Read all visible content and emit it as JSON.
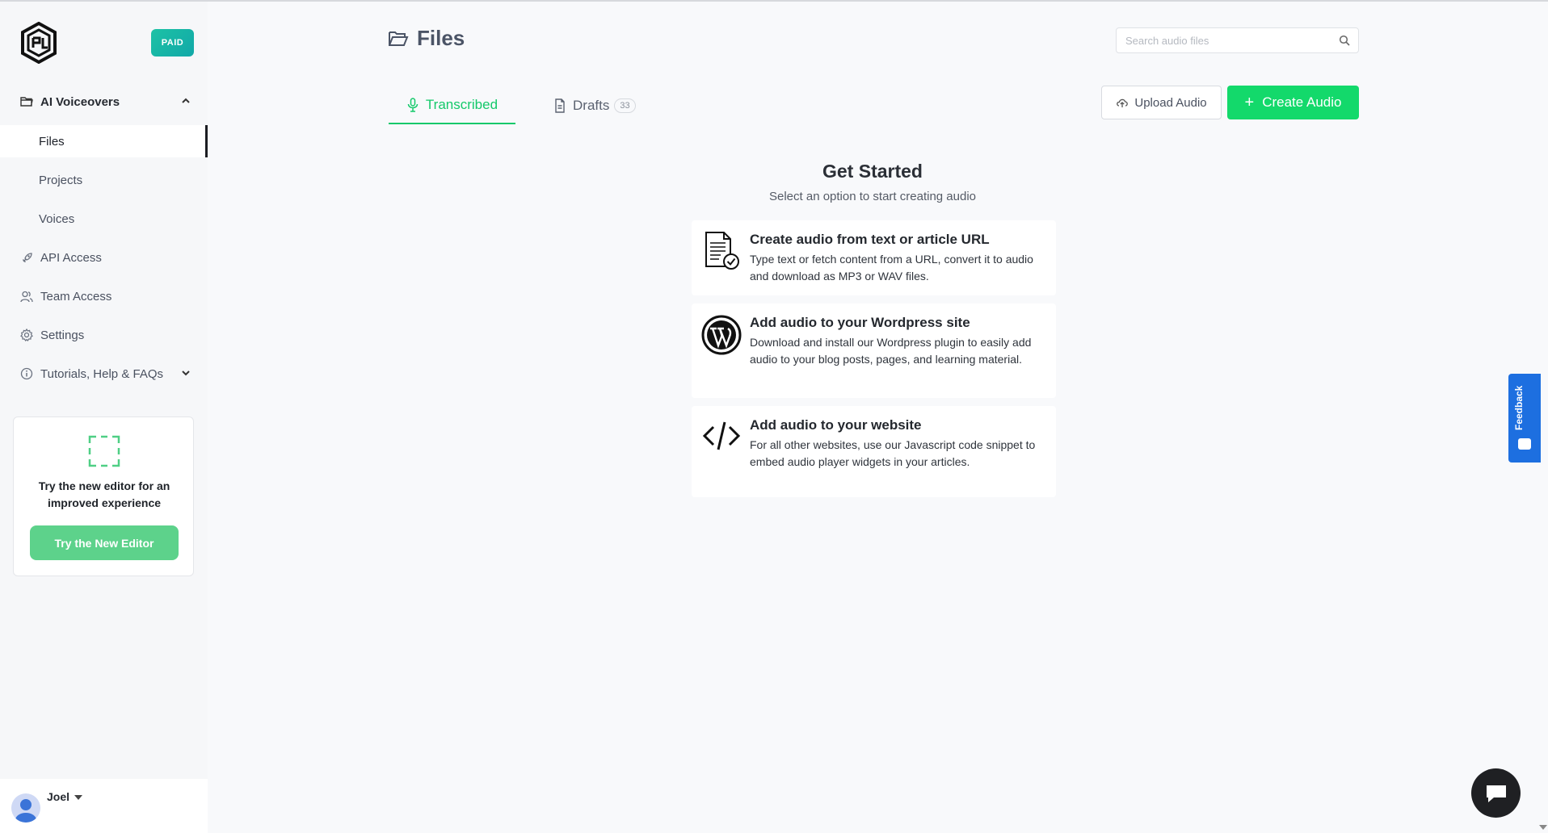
{
  "sidebar": {
    "badge": "PAID",
    "section": {
      "label": "AI Voiceovers"
    },
    "sub_items": [
      "Files",
      "Projects",
      "Voices"
    ],
    "items": [
      {
        "label": "API Access",
        "icon": "rocket-icon"
      },
      {
        "label": "Team Access",
        "icon": "users-icon"
      },
      {
        "label": "Settings",
        "icon": "gear-icon"
      },
      {
        "label": "Tutorials, Help & FAQs",
        "icon": "info-icon"
      }
    ],
    "promo": {
      "text": "Try the new editor for an improved experience",
      "button": "Try the New Editor"
    },
    "user": {
      "name": "Joel"
    }
  },
  "main": {
    "title": "Files",
    "search": {
      "placeholder": "Search audio files"
    },
    "tabs": [
      {
        "label": "Transcribed",
        "icon": "microphone-icon"
      },
      {
        "label": "Drafts",
        "count": "33",
        "icon": "document-icon"
      }
    ],
    "upload_button": "Upload Audio",
    "create_button": "Create Audio",
    "get_started": {
      "title": "Get Started",
      "subtitle": "Select an option to start creating audio",
      "cards": [
        {
          "title": "Create audio from text or article URL",
          "description": "Type text or fetch content from a URL, convert it to audio and download as MP3 or WAV files.",
          "icon": "document-check-icon"
        },
        {
          "title": "Add audio to your Wordpress site",
          "description": "Download and install our Wordpress plugin to easily add audio to your blog posts, pages, and learning material.",
          "icon": "wordpress-icon"
        },
        {
          "title": "Add audio to your website",
          "description": "For all other websites, use our Javascript code snippet to embed audio player widgets in your articles.",
          "icon": "code-icon"
        }
      ]
    }
  },
  "feedback_label": "Feedback",
  "colors": {
    "accent": "#13d96b",
    "badge": "#1dc2a5",
    "promo_button": "#5dd28b",
    "feedback": "#1d6fe0"
  }
}
